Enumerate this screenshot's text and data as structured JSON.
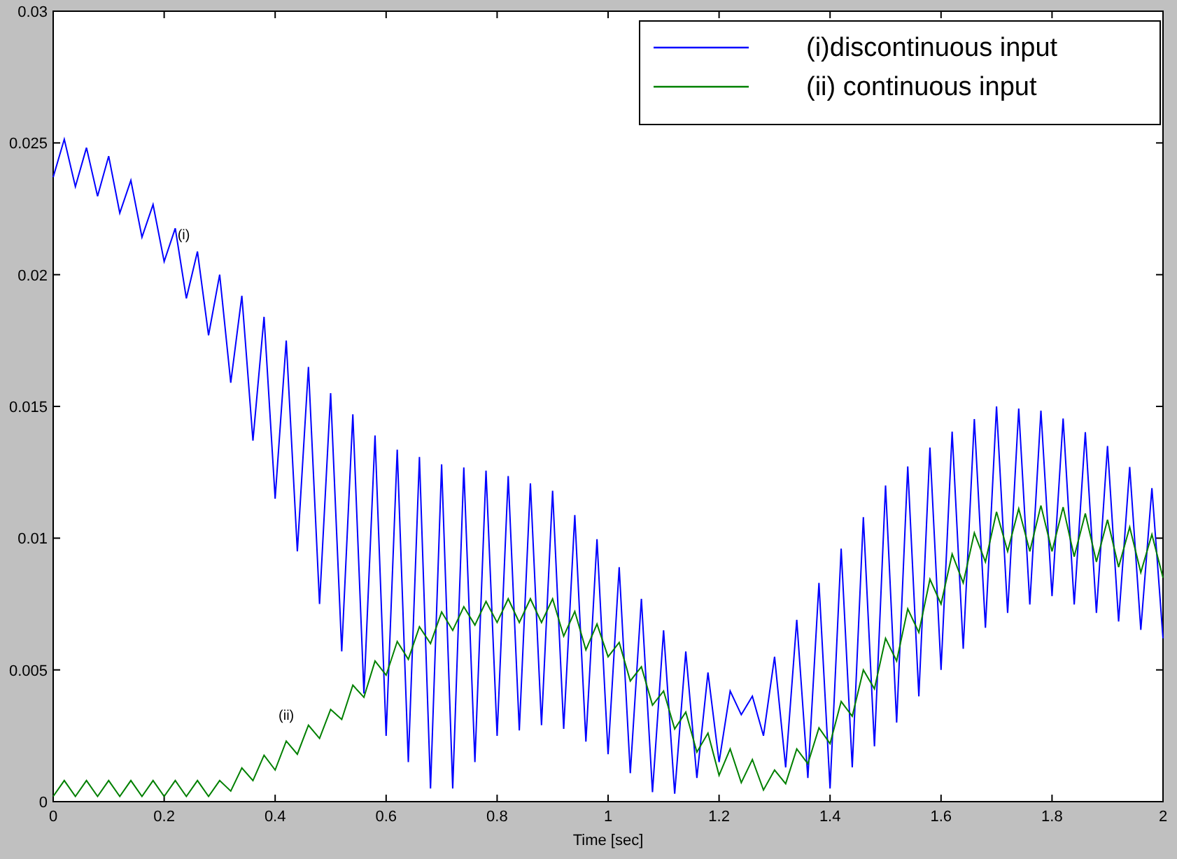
{
  "figure": {
    "chart_data": {
      "type": "line",
      "xlabel": "Time [sec]",
      "x": [
        0,
        0.02,
        0.04,
        0.06,
        0.08,
        0.1,
        0.12,
        0.14,
        0.16,
        0.18,
        0.2,
        0.22,
        0.24,
        0.26,
        0.28,
        0.3,
        0.32,
        0.34,
        0.36,
        0.38,
        0.4,
        0.42,
        0.44,
        0.46,
        0.48,
        0.5,
        0.52,
        0.54,
        0.56,
        0.58,
        0.6,
        0.62,
        0.64,
        0.66,
        0.68,
        0.7,
        0.72,
        0.74,
        0.76,
        0.78,
        0.8,
        0.82,
        0.84,
        0.86,
        0.88,
        0.9,
        0.92,
        0.94,
        0.96,
        0.98,
        1,
        1.02,
        1.04,
        1.06,
        1.08,
        1.1,
        1.12,
        1.14,
        1.16,
        1.18,
        1.2,
        1.22,
        1.24,
        1.26,
        1.28,
        1.3,
        1.32,
        1.34,
        1.36,
        1.38,
        1.4,
        1.42,
        1.44,
        1.46,
        1.48,
        1.5,
        1.52,
        1.54,
        1.56,
        1.58,
        1.6,
        1.62,
        1.64,
        1.66,
        1.68,
        1.7,
        1.72,
        1.74,
        1.76,
        1.78,
        1.8,
        1.82,
        1.84,
        1.86,
        1.88,
        1.9,
        1.92,
        1.94,
        1.96,
        1.98,
        2
      ],
      "series": [
        {
          "name": "(i)discontinuous input",
          "color": "#0000ff",
          "values": [
            0.0237,
            0.02514,
            0.02334,
            0.02482,
            0.02298,
            0.0245,
            0.02234,
            0.02358,
            0.02142,
            0.02266,
            0.0205,
            0.02176,
            0.0191,
            0.02088,
            0.0177,
            0.02,
            0.0159,
            0.0192,
            0.0137,
            0.0184,
            0.0115,
            0.0175,
            0.0095,
            0.0165,
            0.0075,
            0.0155,
            0.0057,
            0.0147,
            0.0041,
            0.0139,
            0.0025,
            0.01336,
            0.0015,
            0.01308,
            0.0005,
            0.0128,
            0.0005,
            0.01268,
            0.0015,
            0.01256,
            0.0025,
            0.01236,
            0.0027,
            0.01208,
            0.0029,
            0.0118,
            0.00276,
            0.01088,
            0.00228,
            0.00996,
            0.0018,
            0.0089,
            0.00108,
            0.0077,
            0.00036,
            0.0065,
            0.0003,
            0.0057,
            0.0009,
            0.0049,
            0.0015,
            0.0042,
            0.0033,
            0.004,
            0.0025,
            0.0055,
            0.0013,
            0.0069,
            0.0009,
            0.0083,
            0.0005,
            0.0096,
            0.0013,
            0.0108,
            0.0021,
            0.012,
            0.003,
            0.01272,
            0.004,
            0.01344,
            0.005,
            0.01404,
            0.0058,
            0.01452,
            0.0066,
            0.015,
            0.00716,
            0.01492,
            0.00748,
            0.01484,
            0.0078,
            0.01454,
            0.00748,
            0.01402,
            0.00716,
            0.0135,
            0.00684,
            0.0127,
            0.00652,
            0.0119,
            0.0062
          ]
        },
        {
          "name": "(ii) continuous input",
          "color": "#008000",
          "values": [
            0.0002,
            0.0008,
            0.0002,
            0.0008,
            0.0002,
            0.0008,
            0.0002,
            0.0008,
            0.0002,
            0.0008,
            0.0002,
            0.0008,
            0.0002,
            0.0008,
            0.0002,
            0.0008,
            0.0004,
            0.00128,
            0.0008,
            0.00176,
            0.0012,
            0.0023,
            0.0018,
            0.0029,
            0.0024,
            0.0035,
            0.00312,
            0.00442,
            0.00396,
            0.00534,
            0.0048,
            0.00608,
            0.0054,
            0.00664,
            0.006,
            0.0072,
            0.0065,
            0.0074,
            0.0067,
            0.0076,
            0.0068,
            0.0077,
            0.0068,
            0.0077,
            0.0068,
            0.0077,
            0.00628,
            0.00722,
            0.00576,
            0.00674,
            0.0055,
            0.00604,
            0.00458,
            0.00512,
            0.00366,
            0.0042,
            0.00276,
            0.0034,
            0.00188,
            0.0026,
            0.001,
            0.002,
            0.00072,
            0.0016,
            0.00044,
            0.0012,
            0.00068,
            0.002,
            0.00144,
            0.0028,
            0.0022,
            0.0038,
            0.00324,
            0.005,
            0.00428,
            0.0062,
            0.00534,
            0.00732,
            0.00642,
            0.00844,
            0.0075,
            0.0094,
            0.0083,
            0.0102,
            0.0091,
            0.011,
            0.0095,
            0.01112,
            0.0095,
            0.01124,
            0.0095,
            0.01118,
            0.0093,
            0.01094,
            0.0091,
            0.0107,
            0.0089,
            0.01042,
            0.0087,
            0.01014,
            0.0085
          ]
        }
      ],
      "xlim": [
        0,
        2
      ],
      "ylim": [
        0,
        0.03
      ],
      "xticks": [
        0,
        0.2,
        0.4,
        0.6,
        0.8,
        1,
        1.2,
        1.4,
        1.6,
        1.8,
        2
      ],
      "yticks": [
        0,
        0.005,
        0.01,
        0.015,
        0.02,
        0.025,
        0.03
      ],
      "annotations": [
        "(i)",
        "(ii)"
      ],
      "legend": true
    }
  }
}
